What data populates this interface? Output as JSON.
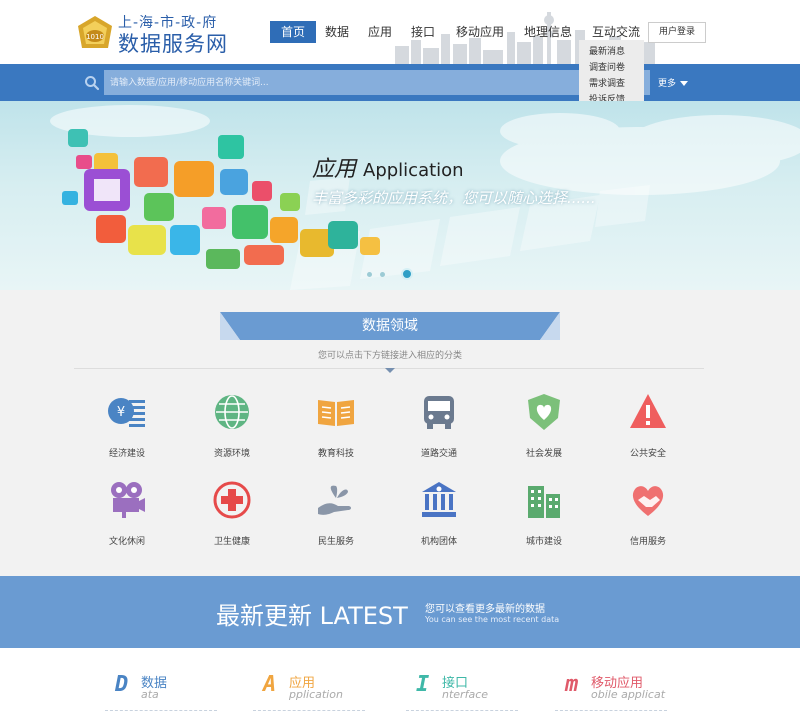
{
  "logo": {
    "top_text": "上-海-市-政-府",
    "main_text": "数据服务网"
  },
  "nav": {
    "items": [
      {
        "label": "首页",
        "active": true
      },
      {
        "label": "数据",
        "active": false
      },
      {
        "label": "应用",
        "active": false
      },
      {
        "label": "接口",
        "active": false
      },
      {
        "label": "移动应用",
        "active": false
      },
      {
        "label": "地理信息",
        "active": false
      },
      {
        "label": "互动交流",
        "active": false
      }
    ],
    "login_label": "用户登录"
  },
  "dropdown": {
    "items": [
      "最新消息",
      "调查问卷",
      "需求调查",
      "投诉反馈"
    ]
  },
  "search": {
    "placeholder": "请输入数据/应用/移动应用名称关键词...",
    "value": "",
    "more_label": "更多"
  },
  "banner": {
    "title_cn": "应用",
    "title_en": "Application",
    "subtitle": "丰富多彩的应用系统，您可以随心选择......",
    "slide_count": 3,
    "active_slide": 3
  },
  "domains": {
    "title": "数据领域",
    "subtitle": "您可以点击下方链接进入相应的分类",
    "categories": [
      {
        "label": "经济建设",
        "icon": "money-list-icon",
        "color": "#4a84c4"
      },
      {
        "label": "资源环境",
        "icon": "globe-icon",
        "color": "#5fb583"
      },
      {
        "label": "教育科技",
        "icon": "open-book-icon",
        "color": "#f0a540"
      },
      {
        "label": "道路交通",
        "icon": "bus-icon",
        "color": "#6b7a8f"
      },
      {
        "label": "社会发展",
        "icon": "shield-heart-icon",
        "color": "#7cc07a"
      },
      {
        "label": "公共安全",
        "icon": "warning-icon",
        "color": "#ef5e5e"
      },
      {
        "label": "文化休闲",
        "icon": "film-camera-icon",
        "color": "#9b6fbf"
      },
      {
        "label": "卫生健康",
        "icon": "medical-cross-icon",
        "color": "#e64a4a"
      },
      {
        "label": "民生服务",
        "icon": "hand-plant-icon",
        "color": "#8a96a8"
      },
      {
        "label": "机构团体",
        "icon": "institution-icon",
        "color": "#4a74c4"
      },
      {
        "label": "城市建设",
        "icon": "buildings-icon",
        "color": "#5aaa6e"
      },
      {
        "label": "信用服务",
        "icon": "handshake-icon",
        "color": "#ef7070"
      }
    ]
  },
  "latest": {
    "title": "最新更新 LATEST",
    "subtitle_cn": "您可以查看更多最新的数据",
    "subtitle_en": "You can see the most recent data"
  },
  "tabs": [
    {
      "letter": "D",
      "cn": "数据",
      "en": "ata",
      "color": "#4a84c4"
    },
    {
      "letter": "A",
      "cn": "应用",
      "en": "pplication",
      "color": "#f0a540"
    },
    {
      "letter": "I",
      "cn": "接口",
      "en": "nterface",
      "color": "#3fb8a8"
    },
    {
      "letter": "m",
      "cn": "移动应用",
      "en": "obile applicat",
      "color": "#e05a6a"
    }
  ]
}
